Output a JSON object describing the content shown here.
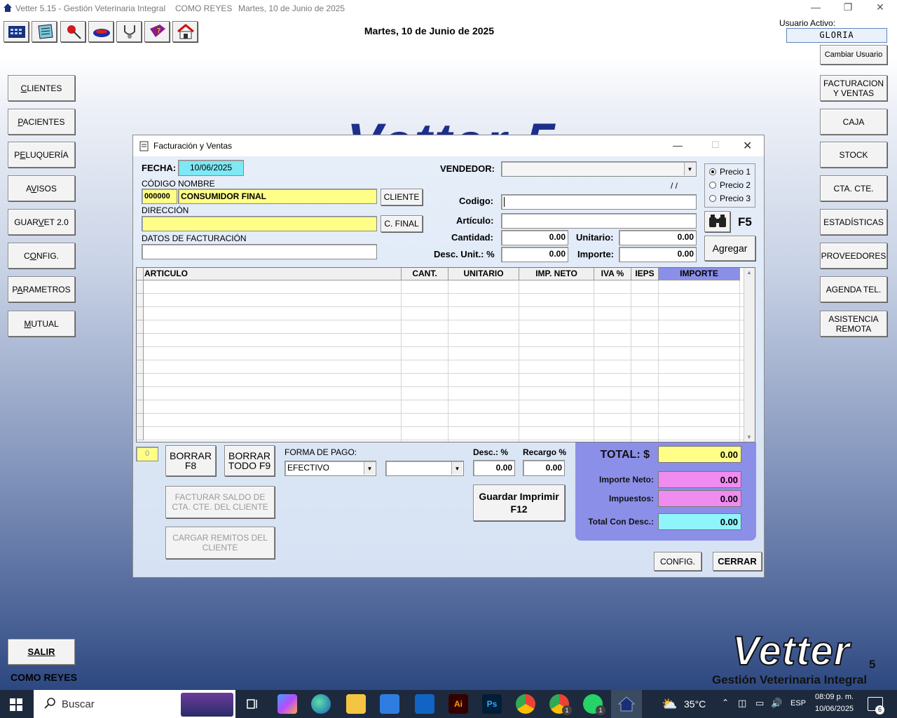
{
  "app": {
    "title": "Vetter 5.15 - Gestión Veterinaria Integral",
    "branch": "COMO REYES",
    "title_date": "Martes, 10 de Junio de 2025",
    "header_date": "Martes, 10 de Junio de 2025",
    "user_label": "Usuario Activo:",
    "user_name": "GLORIA",
    "change_user": "Cambiar Usuario",
    "watermark": "Vetter 5",
    "logo_main": "Vetter",
    "logo_version": "5",
    "logo_sub": "Gestión Veterinaria Integral",
    "footer_branch": "COMO REYES"
  },
  "toolbar": {
    "icons": [
      "calculator-icon",
      "notepad-icon",
      "pushpin-icon",
      "bowl-icon",
      "stethoscope-icon",
      "help-book-icon",
      "kennel-icon"
    ]
  },
  "left_menu": [
    {
      "label": "CLIENTES",
      "key": "C"
    },
    {
      "label": "PACIENTES",
      "key": "P"
    },
    {
      "label": "PELUQUERÍA",
      "key": "E"
    },
    {
      "label": "AVISOS",
      "key": "V"
    },
    {
      "label": "GUARVET 2.0",
      "key": "V"
    },
    {
      "label": "CONFIG.",
      "key": "O"
    },
    {
      "label": "PARAMETROS",
      "key": "A"
    },
    {
      "label": "MUTUAL",
      "key": "M"
    }
  ],
  "exit_label": "SALIR",
  "right_menu": [
    {
      "label": "FACTURACION\nY VENTAS"
    },
    {
      "label": "CAJA"
    },
    {
      "label": "STOCK"
    },
    {
      "label": "CTA. CTE."
    },
    {
      "label": "ESTADÍSTICAS"
    },
    {
      "label": "PROVEEDORES"
    },
    {
      "label": "AGENDA TEL."
    },
    {
      "label": "ASISTENCIA\nREMOTA"
    }
  ],
  "dialog": {
    "title": "Facturación y Ventas",
    "fecha_label": "FECHA:",
    "fecha_value": "10/06/2025",
    "codigo_nombre_label": "CÓDIGO NOMBRE",
    "client_code": "000000",
    "client_name": "CONSUMIDOR FINAL",
    "cliente_btn": "CLIENTE",
    "direccion_label": "DIRECCIÓN",
    "direccion_value": "",
    "cfinal_btn": "C. FINAL",
    "datos_label": "DATOS DE FACTURACIÓN",
    "datos_value": "",
    "vendedor_label": "VENDEDOR:",
    "vendedor_value": "",
    "date_placeholder": "/ /",
    "price_options": [
      "Precio 1",
      "Precio 2",
      "Precio 3"
    ],
    "price_selected": "Precio 1",
    "codigo_label": "Codigo:",
    "codigo_value": "",
    "articulo_label": "Artículo:",
    "articulo_value": "",
    "cantidad_label": "Cantidad:",
    "cantidad_value": "0.00",
    "unitario_label": "Unitario:",
    "unitario_value": "0.00",
    "desc_unit_label": "Desc. Unit.: %",
    "desc_unit_value": "0.00",
    "importe_label": "Importe:",
    "importe_value": "0.00",
    "search_key": "F5",
    "agregar_btn": "Agregar",
    "grid_columns": [
      "ARTICULO",
      "CANT.",
      "UNITARIO",
      "IMP. NETO",
      "IVA %",
      "IEPS",
      "IMPORTE"
    ],
    "item_count": "0",
    "borrar_btn": "BORRAR\nF8",
    "borrar_todo_btn": "BORRAR\nTODO F9",
    "forma_pago_label": "FORMA DE PAGO:",
    "forma_pago_value": "EFECTIVO",
    "forma_pago_2": "",
    "desc_label": "Desc.: %",
    "desc_value": "0.00",
    "recargo_label": "Recargo %",
    "recargo_value": "0.00",
    "facturar_saldo_btn": "FACTURAR SALDO DE\nCTA. CTE. DEL CLIENTE",
    "cargar_remitos_btn": "CARGAR REMITOS DEL\nCLIENTE",
    "guardar_btn": "Guardar Imprimir\nF12",
    "total_label": "TOTAL: $",
    "total_value": "0.00",
    "neto_label": "Importe Neto:",
    "neto_value": "0.00",
    "impuestos_label": "Impuestos:",
    "impuestos_value": "0.00",
    "total_desc_label": "Total Con Desc.:",
    "total_desc_value": "0.00",
    "config_btn": "CONFIG.",
    "cerrar_btn": "CERRAR"
  },
  "taskbar": {
    "search_placeholder": "Buscar",
    "weather": "35°C",
    "lang": "ESP",
    "time": "08:09 p. m.",
    "date": "10/06/2025",
    "notif_count": "6",
    "whatsapp_badge": "1",
    "chrome_badge": "1"
  }
}
